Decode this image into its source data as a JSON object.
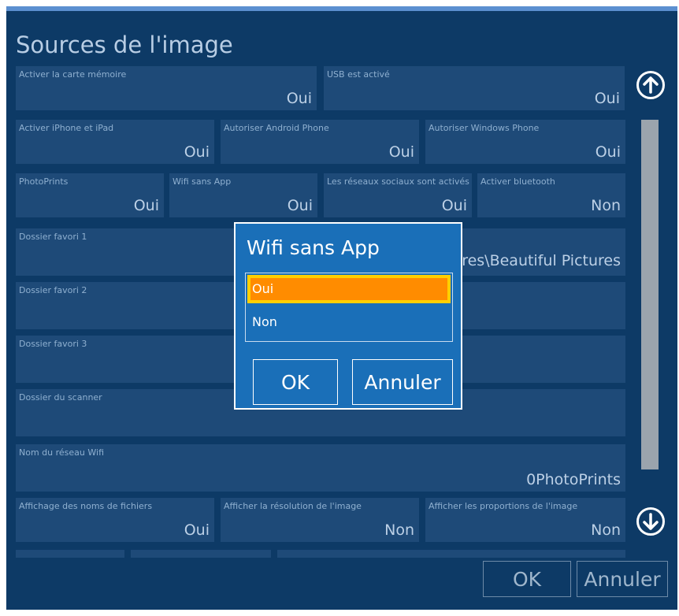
{
  "window": {
    "title": "Sources de l'image"
  },
  "fields": {
    "carte_memoire": {
      "label": "Activer la carte mémoire",
      "value": "Oui"
    },
    "usb": {
      "label": "USB est activé",
      "value": "Oui"
    },
    "iphone": {
      "label": "Activer iPhone et iPad",
      "value": "Oui"
    },
    "android": {
      "label": "Autoriser Android Phone",
      "value": "Oui"
    },
    "windows_phone": {
      "label": "Autoriser Windows Phone",
      "value": "Oui"
    },
    "photoprints": {
      "label": "PhotoPrints",
      "value": "Oui"
    },
    "wifi_sans_app": {
      "label": "Wifi sans App",
      "value": "Oui"
    },
    "reseaux_sociaux": {
      "label": "Les réseaux sociaux sont activés",
      "value": "Oui"
    },
    "bluetooth": {
      "label": "Activer bluetooth",
      "value": "Non"
    },
    "favori1": {
      "label": "Dossier favori 1",
      "value": "res\\Beautiful Pictures"
    },
    "favori2": {
      "label": "Dossier favori 2",
      "value": ""
    },
    "favori3": {
      "label": "Dossier favori 3",
      "value": ""
    },
    "scanner": {
      "label": "Dossier du scanner",
      "value": ""
    },
    "wifi_name": {
      "label": "Nom du réseau Wifi",
      "value": "0PhotoPrints"
    },
    "noms_fichiers": {
      "label": "Affichage des noms de fichiers",
      "value": "Oui"
    },
    "resolution": {
      "label": "Afficher la résolution de l'image",
      "value": "Non"
    },
    "proportions": {
      "label": "Afficher les proportions de l'image",
      "value": "Non"
    }
  },
  "footer": {
    "ok_label": "OK",
    "cancel_label": "Annuler"
  },
  "dialog": {
    "title": "Wifi sans App",
    "options": [
      "Oui",
      "Non"
    ],
    "selected": "Oui",
    "ok_label": "OK",
    "cancel_label": "Annuler"
  },
  "icons": {
    "scroll_up": "arrow-up-circle",
    "scroll_down": "arrow-down-circle"
  },
  "colors": {
    "background": "#0d3a66",
    "field": "#1e4a78",
    "dialog": "#1a6fb8",
    "selection": "#ff8c00",
    "selection_border": "#ffcf00"
  }
}
